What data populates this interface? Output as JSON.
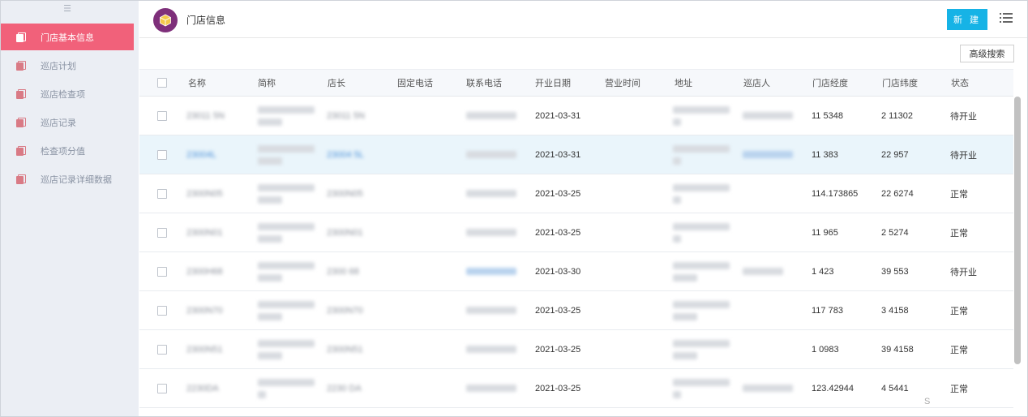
{
  "header": {
    "title": "门店信息",
    "new_label": "新 建"
  },
  "toolbar": {
    "advanced_search_label": "高级搜索"
  },
  "sidebar": {
    "items": [
      {
        "label": "门店基本信息",
        "active": true
      },
      {
        "label": "巡店计划",
        "active": false
      },
      {
        "label": "巡店检查项",
        "active": false
      },
      {
        "label": "巡店记录",
        "active": false
      },
      {
        "label": "检查项分值",
        "active": false
      },
      {
        "label": "巡店记录详细数据",
        "active": false
      }
    ]
  },
  "table": {
    "columns": [
      "名称",
      "简称",
      "店长",
      "固定电话",
      "联系电话",
      "开业日期",
      "营业时间",
      "地址",
      "巡店人",
      "门店经度",
      "门店纬度",
      "状态"
    ],
    "rows": [
      {
        "name": "23011 5N",
        "manager": "23011 5N",
        "open_date": "2021-03-31",
        "lng": "11 5348",
        "lat": "2 11302",
        "status": "待开业"
      },
      {
        "name": "23004L",
        "manager": "23004 5L",
        "open_date": "2021-03-31",
        "lng": "11 383",
        "lat": "22 957",
        "status": "待开业"
      },
      {
        "name": "2300N05",
        "manager": "2300N05",
        "open_date": "2021-03-25",
        "lng": "114.173865",
        "lat": "22 6274",
        "status": "正常"
      },
      {
        "name": "2300N01",
        "manager": "2300N01",
        "open_date": "2021-03-25",
        "lng": "11 965",
        "lat": "2 5274",
        "status": "正常"
      },
      {
        "name": "2300H68",
        "manager": "2300 68",
        "open_date": "2021-03-30",
        "lng": "1 423",
        "lat": "39 553",
        "status": "待开业"
      },
      {
        "name": "2300N70",
        "manager": "2300N70",
        "open_date": "2021-03-25",
        "lng": "117 783",
        "lat": "3 4158",
        "status": "正常"
      },
      {
        "name": "2300N51",
        "manager": "2300N51",
        "open_date": "2021-03-25",
        "lng": "1 0983",
        "lat": "39 4158",
        "status": "正常"
      },
      {
        "name": "2230DA",
        "manager": "2230 DA",
        "open_date": "2021-03-25",
        "lng": "123.42944",
        "lat": "4 5441",
        "status": "正常"
      }
    ]
  },
  "footer": {
    "corner_text": "S"
  },
  "colors": {
    "accent": "#16b3e6",
    "active_nav": "#f1617a",
    "logo": "#7e2f7a"
  },
  "icons": {
    "logo": "cube-icon",
    "menu": "list-icon",
    "nav": "document-icon"
  }
}
